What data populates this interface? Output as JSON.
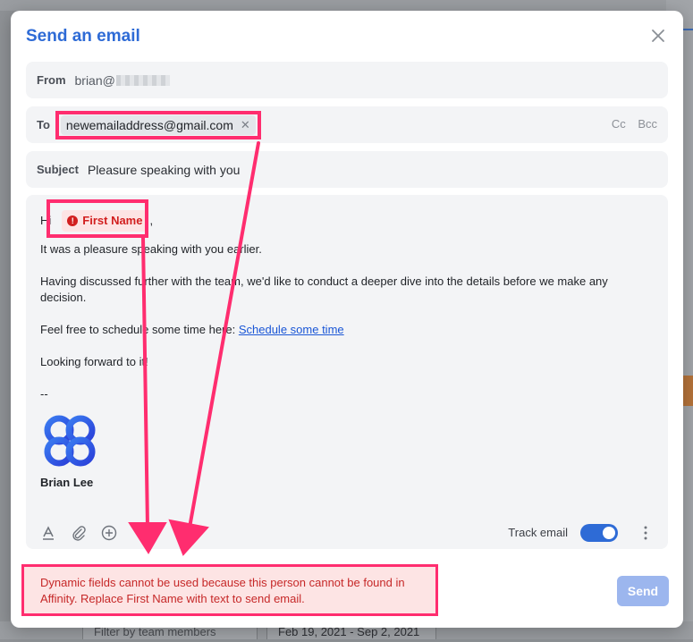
{
  "background": {
    "filter_placeholder": "Filter by team members",
    "date_range": "Feb 19, 2021 - Sep 2, 2021"
  },
  "modal": {
    "title": "Send an email",
    "from_label": "From",
    "from_value": "brian@",
    "to_label": "To",
    "to_chip": "newemailaddress@gmail.com",
    "cc_label": "Cc",
    "bcc_label": "Bcc",
    "subject_label": "Subject",
    "subject_value": "Pleasure speaking with you"
  },
  "body": {
    "greeting_prefix": "Hi",
    "dynamic_field": "First Name",
    "greeting_suffix": ",",
    "line1": "It was a pleasure speaking with you earlier.",
    "line2": "Having discussed further with the team, we'd like to conduct a deeper dive into the details before we make any decision.",
    "line3_prefix": "Feel free to schedule some time here: ",
    "line3_link": "Schedule some time",
    "line4": "Looking forward to it!",
    "separator": "--",
    "signature_name": "Brian Lee"
  },
  "toolbar": {
    "track_label": "Track email",
    "track_on": true
  },
  "error": {
    "message": "Dynamic fields cannot be used because this person cannot be found in Affinity. Replace First Name with text to send email."
  },
  "send_label": "Send",
  "colors": {
    "accent": "#2e6bd6",
    "error": "#c62828",
    "highlight": "#ff2d6f"
  }
}
